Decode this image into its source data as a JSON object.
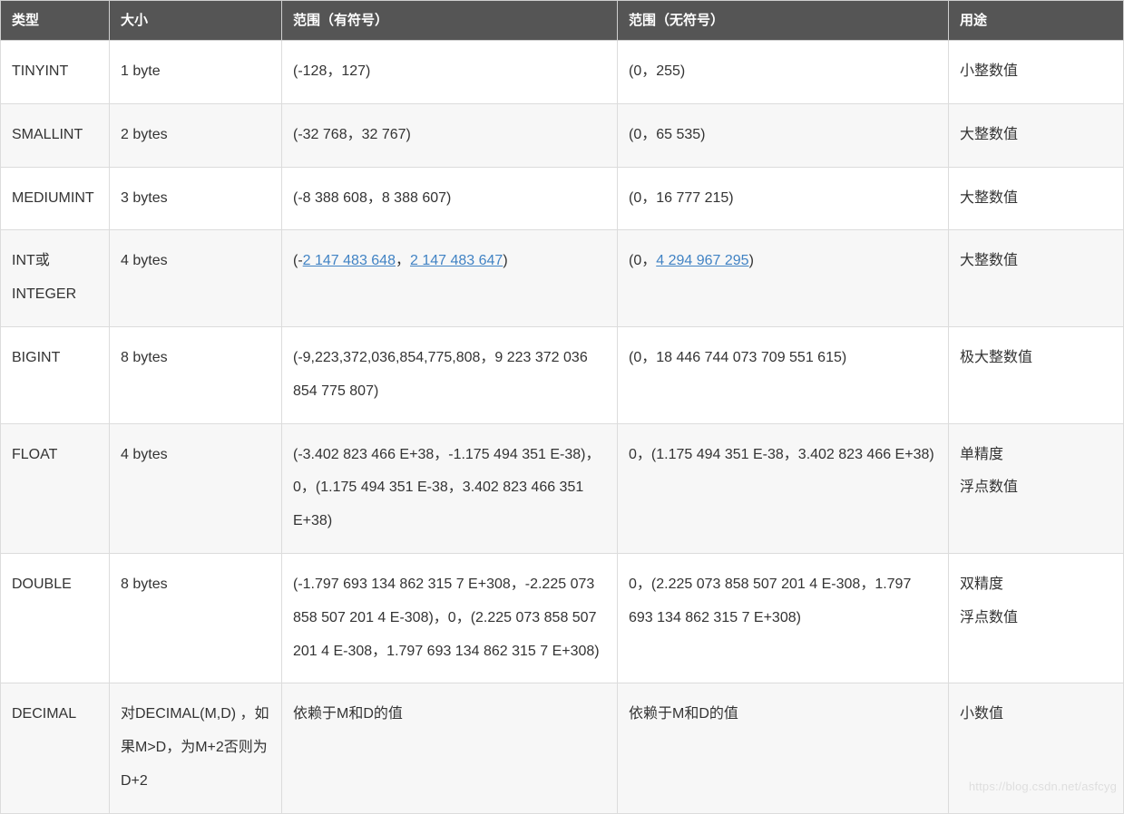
{
  "table": {
    "headers": {
      "type": "类型",
      "size": "大小",
      "signed": "范围（有符号）",
      "unsigned": "范围（无符号）",
      "usage": "用途"
    },
    "rows": [
      {
        "type": "TINYINT",
        "size": "1 byte",
        "signed_plain": "(-128，127)",
        "unsigned_plain": "(0，255)",
        "usage": "小整数值"
      },
      {
        "type": "SMALLINT",
        "size": "2 bytes",
        "signed_plain": "(-32 768，32 767)",
        "unsigned_plain": "(0，65 535)",
        "usage": "大整数值"
      },
      {
        "type": "MEDIUMINT",
        "size": "3 bytes",
        "signed_plain": "(-8 388 608，8 388 607)",
        "unsigned_plain": "(0，16 777 215)",
        "usage": "大整数值"
      },
      {
        "type": "INT或INTEGER",
        "size": "4 bytes",
        "signed_parts": {
          "pre": "(-",
          "link1": "2 147 483 648",
          "mid": "，",
          "link2": "2 147 483 647",
          "post": ")"
        },
        "unsigned_parts": {
          "pre": "(0，",
          "link": "4 294 967 295",
          "post": ")"
        },
        "usage": "大整数值"
      },
      {
        "type": "BIGINT",
        "size": "8 bytes",
        "signed_plain": "(-9,223,372,036,854,775,808，9 223 372 036 854 775 807)",
        "unsigned_plain": "(0，18 446 744 073 709 551 615)",
        "usage": "极大整数值"
      },
      {
        "type": "FLOAT",
        "size": "4 bytes",
        "signed_plain": "(-3.402 823 466 E+38，-1.175 494 351 E-38)，0，(1.175 494 351 E-38，3.402 823 466 351 E+38)",
        "unsigned_plain": "0，(1.175 494 351 E-38，3.402 823 466 E+38)",
        "usage_line1": "单精度",
        "usage_line2": "浮点数值"
      },
      {
        "type": "DOUBLE",
        "size": "8 bytes",
        "signed_plain": "(-1.797 693 134 862 315 7 E+308，-2.225 073 858 507 201 4 E-308)，0，(2.225 073 858 507 201 4 E-308，1.797 693 134 862 315 7 E+308)",
        "unsigned_plain": "0，(2.225 073 858 507 201 4 E-308，1.797 693 134 862 315 7 E+308)",
        "usage_line1": "双精度",
        "usage_line2": "浮点数值"
      },
      {
        "type": "DECIMAL",
        "size": "对DECIMAL(M,D) ，如果M>D，为M+2否则为D+2",
        "signed_plain": "依赖于M和D的值",
        "unsigned_plain": "依赖于M和D的值",
        "usage": "小数值"
      }
    ]
  },
  "watermark": "https://blog.csdn.net/asfcyg"
}
